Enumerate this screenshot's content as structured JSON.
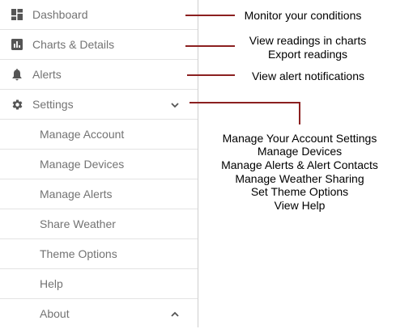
{
  "sidebar": {
    "items": [
      {
        "label": "Dashboard",
        "icon": "dashboard-icon"
      },
      {
        "label": "Charts & Details",
        "icon": "bar-chart-icon"
      },
      {
        "label": "Alerts",
        "icon": "bell-icon"
      },
      {
        "label": "Settings",
        "icon": "gear-icon",
        "expand_icon": "chevron-down-icon"
      }
    ],
    "settings_submenu": [
      {
        "label": "Manage Account"
      },
      {
        "label": "Manage Devices"
      },
      {
        "label": "Manage Alerts"
      },
      {
        "label": "Share Weather"
      },
      {
        "label": "Theme Options"
      },
      {
        "label": "Help"
      },
      {
        "label": "About",
        "expand_icon": "chevron-up-icon"
      }
    ]
  },
  "annotations": {
    "dashboard": "Monitor your conditions",
    "charts_line1": "View readings in charts",
    "charts_line2": "Export readings",
    "alerts": "View alert notifications",
    "settings_lines": [
      "Manage Your Account Settings",
      "Manage Devices",
      "Manage Alerts & Alert Contacts",
      "Manage Weather Sharing",
      "Set Theme Options",
      "View Help"
    ]
  },
  "colors": {
    "callout_line": "#8b2020",
    "icon": "#555555",
    "label": "#737373"
  }
}
